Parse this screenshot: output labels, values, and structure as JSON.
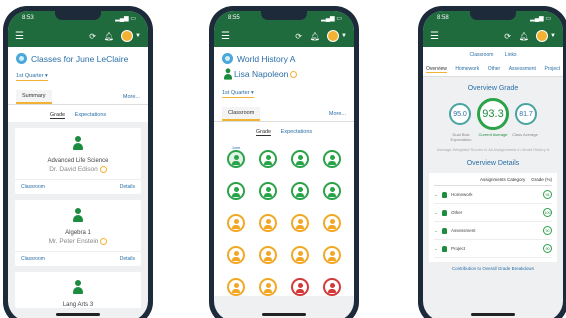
{
  "colors": {
    "primary": "#1f6b3d",
    "accent": "#f3b233",
    "link": "#2a6fa8",
    "green": "#2aa34a",
    "orange": "#f3a825",
    "red": "#d23a3a"
  },
  "phone1": {
    "status_time": "8:53",
    "title": "Classes for June LeClaire",
    "quarter": "1st Quarter",
    "tab": "Summary",
    "more": "More...",
    "subtabs": [
      "Grade",
      "Expectations"
    ],
    "cards": [
      {
        "course": "Advanced Life Science",
        "teacher": "Dr. David Edison",
        "left": "Classroom",
        "right": "Details"
      },
      {
        "course": "Algebra 1",
        "teacher": "Mr. Peter Enstein",
        "left": "Classroom",
        "right": "Details"
      },
      {
        "course": "Lang Arts 3",
        "teacher": "",
        "left": "",
        "right": ""
      }
    ]
  },
  "phone2": {
    "status_time": "8:55",
    "title": "World History A",
    "student": "Lisa Napoleon",
    "quarter": "1st Quarter",
    "tab": "Classroom",
    "more": "More...",
    "subtabs": [
      "Grade",
      "Expectations"
    ],
    "selected_label": "June",
    "rows": [
      [
        "g",
        "g",
        "g",
        "g"
      ],
      [
        "g",
        "g",
        "g",
        "g"
      ],
      [
        "o",
        "o",
        "o",
        "o"
      ],
      [
        "o",
        "o",
        "o",
        "o"
      ],
      [
        "o",
        "o",
        "r",
        "r"
      ]
    ]
  },
  "phone3": {
    "status_time": "8:58",
    "links": [
      "Classroom",
      "Links"
    ],
    "tabs": [
      "Overview",
      "Homework",
      "Other",
      "Assessment",
      "Project"
    ],
    "overview_title": "Overview Grade",
    "left_value": "95.0",
    "center_value": "93.3",
    "right_value": "81.7",
    "left_label": "Dual Bias Expectation",
    "center_label": "Current Average",
    "right_label": "Class Average",
    "note": "Average Weighted Scores in All Assignments in World History A",
    "details_title": "Overview Details",
    "col_category": "Assignments Category",
    "col_grade": "Grade (%)",
    "rows": [
      {
        "name": "Homework",
        "grade": "94"
      },
      {
        "name": "Other",
        "grade": "100"
      },
      {
        "name": "Assessment",
        "grade": "90"
      },
      {
        "name": "Project",
        "grade": "90"
      }
    ],
    "footer": "Contribution to Overall Grade Breakdown"
  }
}
